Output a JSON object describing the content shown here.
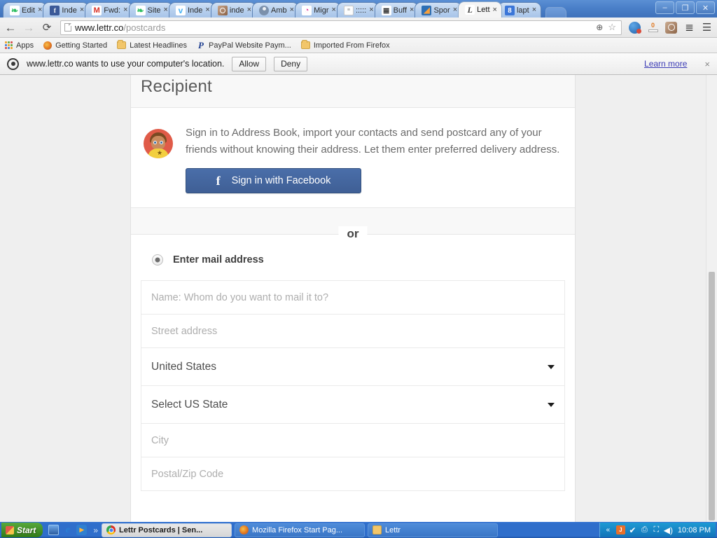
{
  "browser": {
    "tabs": [
      {
        "label": "Edit",
        "icon": "evernote-icon",
        "icon_class": "fav-evernote",
        "glyph": "❧",
        "active": false
      },
      {
        "label": "Inde",
        "icon": "facebook-icon",
        "icon_class": "fav-fb",
        "glyph": "f",
        "active": false
      },
      {
        "label": "Fwd:",
        "icon": "gmail-icon",
        "icon_class": "fav-gmail",
        "glyph": "M",
        "active": false
      },
      {
        "label": "Site",
        "icon": "evernote-icon",
        "icon_class": "fav-evernote",
        "glyph": "❧",
        "active": false
      },
      {
        "label": "Inde",
        "icon": "twitter-icon",
        "icon_class": "fav-tw",
        "glyph": "ᴠ",
        "active": false
      },
      {
        "label": "inde",
        "icon": "instagram-icon",
        "icon_class": "fav-ig",
        "glyph": "",
        "active": false
      },
      {
        "label": "Amb",
        "icon": "person-avatar-icon",
        "icon_class": "fav-person",
        "glyph": "",
        "active": false
      },
      {
        "label": "Migr",
        "icon": "magenta-site-icon",
        "icon_class": "fav-magenta",
        "glyph": "◔",
        "active": false
      },
      {
        "label": ":::::",
        "icon": "blank-page-icon",
        "icon_class": "fav-doc",
        "glyph": "≡",
        "active": false
      },
      {
        "label": "Buff",
        "icon": "buffer-icon",
        "icon_class": "fav-buffer",
        "glyph": "≣",
        "active": false
      },
      {
        "label": "Spor",
        "icon": "sports-icon",
        "icon_class": "fav-spor",
        "glyph": "◢",
        "active": false
      },
      {
        "label": "Lett",
        "icon": "lettr-icon",
        "icon_class": "fav-lettr",
        "glyph": "L",
        "active": true
      },
      {
        "label": "lapt",
        "icon": "google-icon",
        "icon_class": "fav-g8",
        "glyph": "8",
        "active": false
      }
    ],
    "tab_close_glyph": "×",
    "window_controls": {
      "minimize": "–",
      "restore": "❐",
      "close": "✕"
    },
    "toolbar": {
      "back": "←",
      "forward": "→",
      "reload": "⟳",
      "url_host": "www.lettr.co",
      "url_path": "/postcards",
      "zoom_icon": "⊕",
      "star_icon": "☆",
      "extensions": [
        {
          "name": "ball-extension-icon",
          "class": "ext-ball",
          "glyph": ""
        },
        {
          "name": "counter-extension-icon",
          "class": "ext-zero",
          "glyph": "0"
        },
        {
          "name": "instagram-extension-icon",
          "class": "ext-ig",
          "glyph": ""
        },
        {
          "name": "buffer-extension-icon",
          "class": "ext-buffer",
          "glyph": "≣"
        }
      ],
      "menu_icon": "☰"
    },
    "bookmarks": [
      {
        "label": "Apps",
        "icon": "apps-grid-icon",
        "icon_class": "bm-apps"
      },
      {
        "label": "Getting Started",
        "icon": "firefox-icon",
        "icon_class": "bm-ff"
      },
      {
        "label": "Latest Headlines",
        "icon": "folder-icon",
        "icon_class": "bm-folder"
      },
      {
        "label": "PayPal Website Paym...",
        "icon": "paypal-icon",
        "icon_class": "bm-pp"
      },
      {
        "label": "Imported From Firefox",
        "icon": "folder-icon",
        "icon_class": "bm-folder"
      }
    ],
    "infobar": {
      "icon": "location-crosshair-icon",
      "message": "www.lettr.co wants to use your computer's location.",
      "allow_label": "Allow",
      "deny_label": "Deny",
      "learn_more_label": "Learn more",
      "close_glyph": "×"
    }
  },
  "page": {
    "title": "Recipient",
    "signin": {
      "avatar_name": "recipient-avatar",
      "description": "Sign in to Address Book, import your contacts and send postcard any of your friends without knowing their address. Let them enter preferred delivery address.",
      "facebook_button": "Sign in with Facebook",
      "facebook_glyph": "f"
    },
    "divider_label": "or",
    "manual": {
      "radio_label": "Enter mail address",
      "radio_selected": true,
      "fields": [
        {
          "name": "recipient-name-input",
          "type": "text",
          "placeholder": "Name: Whom do you want to mail it to?",
          "value": ""
        },
        {
          "name": "street-address-input",
          "type": "text",
          "placeholder": "Street address",
          "value": ""
        },
        {
          "name": "country-select",
          "type": "select",
          "value": "United States"
        },
        {
          "name": "state-select",
          "type": "select",
          "value": "Select US State"
        },
        {
          "name": "city-input",
          "type": "text",
          "placeholder": "City",
          "value": ""
        },
        {
          "name": "postal-code-input",
          "type": "text",
          "placeholder": "Postal/Zip Code",
          "value": ""
        }
      ]
    }
  },
  "taskbar": {
    "start_label": "Start",
    "quicklaunch": [
      {
        "name": "show-desktop-icon",
        "class": "ql-desk",
        "glyph": ""
      },
      {
        "name": "internet-explorer-icon",
        "class": "ql-ie",
        "glyph": "e"
      },
      {
        "name": "windows-media-player-icon",
        "class": "ql-wmp",
        "glyph": "▶"
      }
    ],
    "overflow_glyph": "»",
    "tasks": [
      {
        "label": "Lettr Postcards | Sen...",
        "icon": "chrome-icon",
        "icon_class": "tico-chrome",
        "active": true
      },
      {
        "label": "Mozilla Firefox Start Pag...",
        "icon": "firefox-icon",
        "icon_class": "tico-ff",
        "active": false
      },
      {
        "label": "Lettr",
        "icon": "folder-icon",
        "icon_class": "tico-folder",
        "active": false
      }
    ],
    "tray": {
      "expand_glyph": "«",
      "icons": [
        {
          "name": "java-tray-icon",
          "class": "tr-java",
          "glyph": "J"
        },
        {
          "name": "security-shield-tray-icon",
          "class": "tr-shield",
          "glyph": "✔"
        },
        {
          "name": "printer-tray-icon",
          "class": "tr-print",
          "glyph": "⎙"
        },
        {
          "name": "network-tray-icon",
          "class": "tr-net",
          "glyph": "⛶"
        },
        {
          "name": "volume-tray-icon",
          "class": "tr-vol",
          "glyph": "◀)"
        }
      ],
      "clock": "10:08 PM"
    }
  },
  "colors": {
    "facebook_blue": "#44659f",
    "avatar_red": "#e05b48",
    "link_blue": "#3a3ab5",
    "taskbar_blue": "#2f6ecb"
  }
}
